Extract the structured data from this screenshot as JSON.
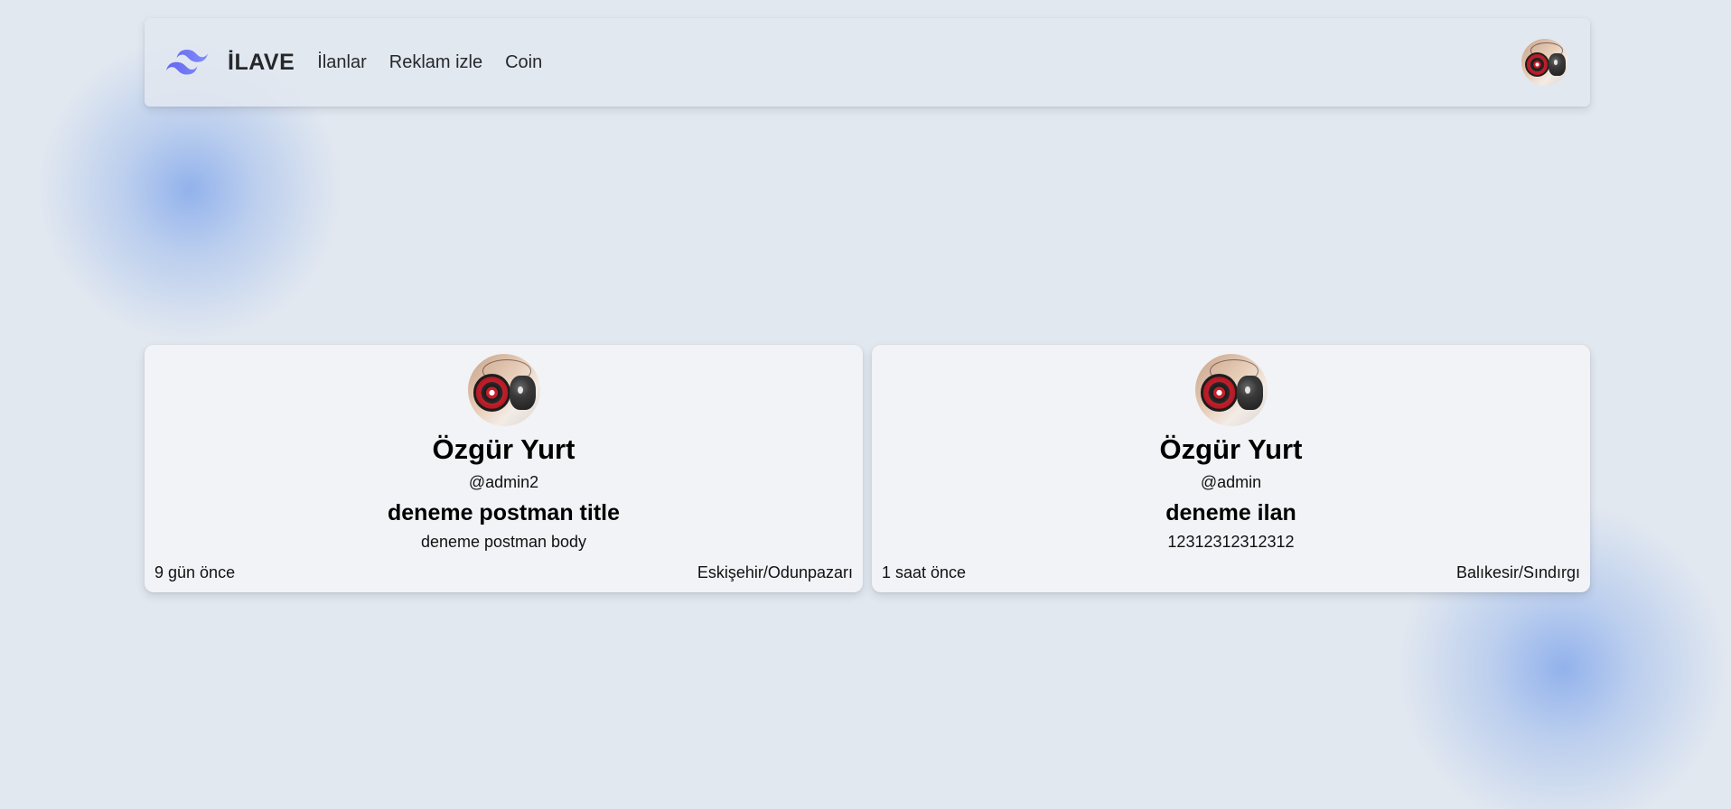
{
  "navbar": {
    "brand_name": "İLAVE",
    "brand_logo_icon": "tailwind-wave-logo-icon",
    "links": [
      {
        "label": "İlanlar"
      },
      {
        "label": "Reklam izle"
      },
      {
        "label": "Coin"
      }
    ],
    "user_avatar_icon": "user-avatar-photo"
  },
  "listings": [
    {
      "author_name": "Özgür Yurt",
      "username": "@admin2",
      "title": "deneme postman title",
      "body": "deneme postman body",
      "time_ago": "9 gün önce",
      "location": "Eskişehir/Odunpazarı"
    },
    {
      "author_name": "Özgür Yurt",
      "username": "@admin",
      "title": "deneme ilan",
      "body": "12312312312312",
      "time_ago": "1 saat önce",
      "location": "Balıkesir/Sındırgı"
    }
  ],
  "colors": {
    "background": "#e2e8f0",
    "card_background": "#f1f3f6",
    "logo_gradient_start": "#6366f1",
    "logo_gradient_end": "#818cf8",
    "blob_accent": "#93b4ec"
  }
}
